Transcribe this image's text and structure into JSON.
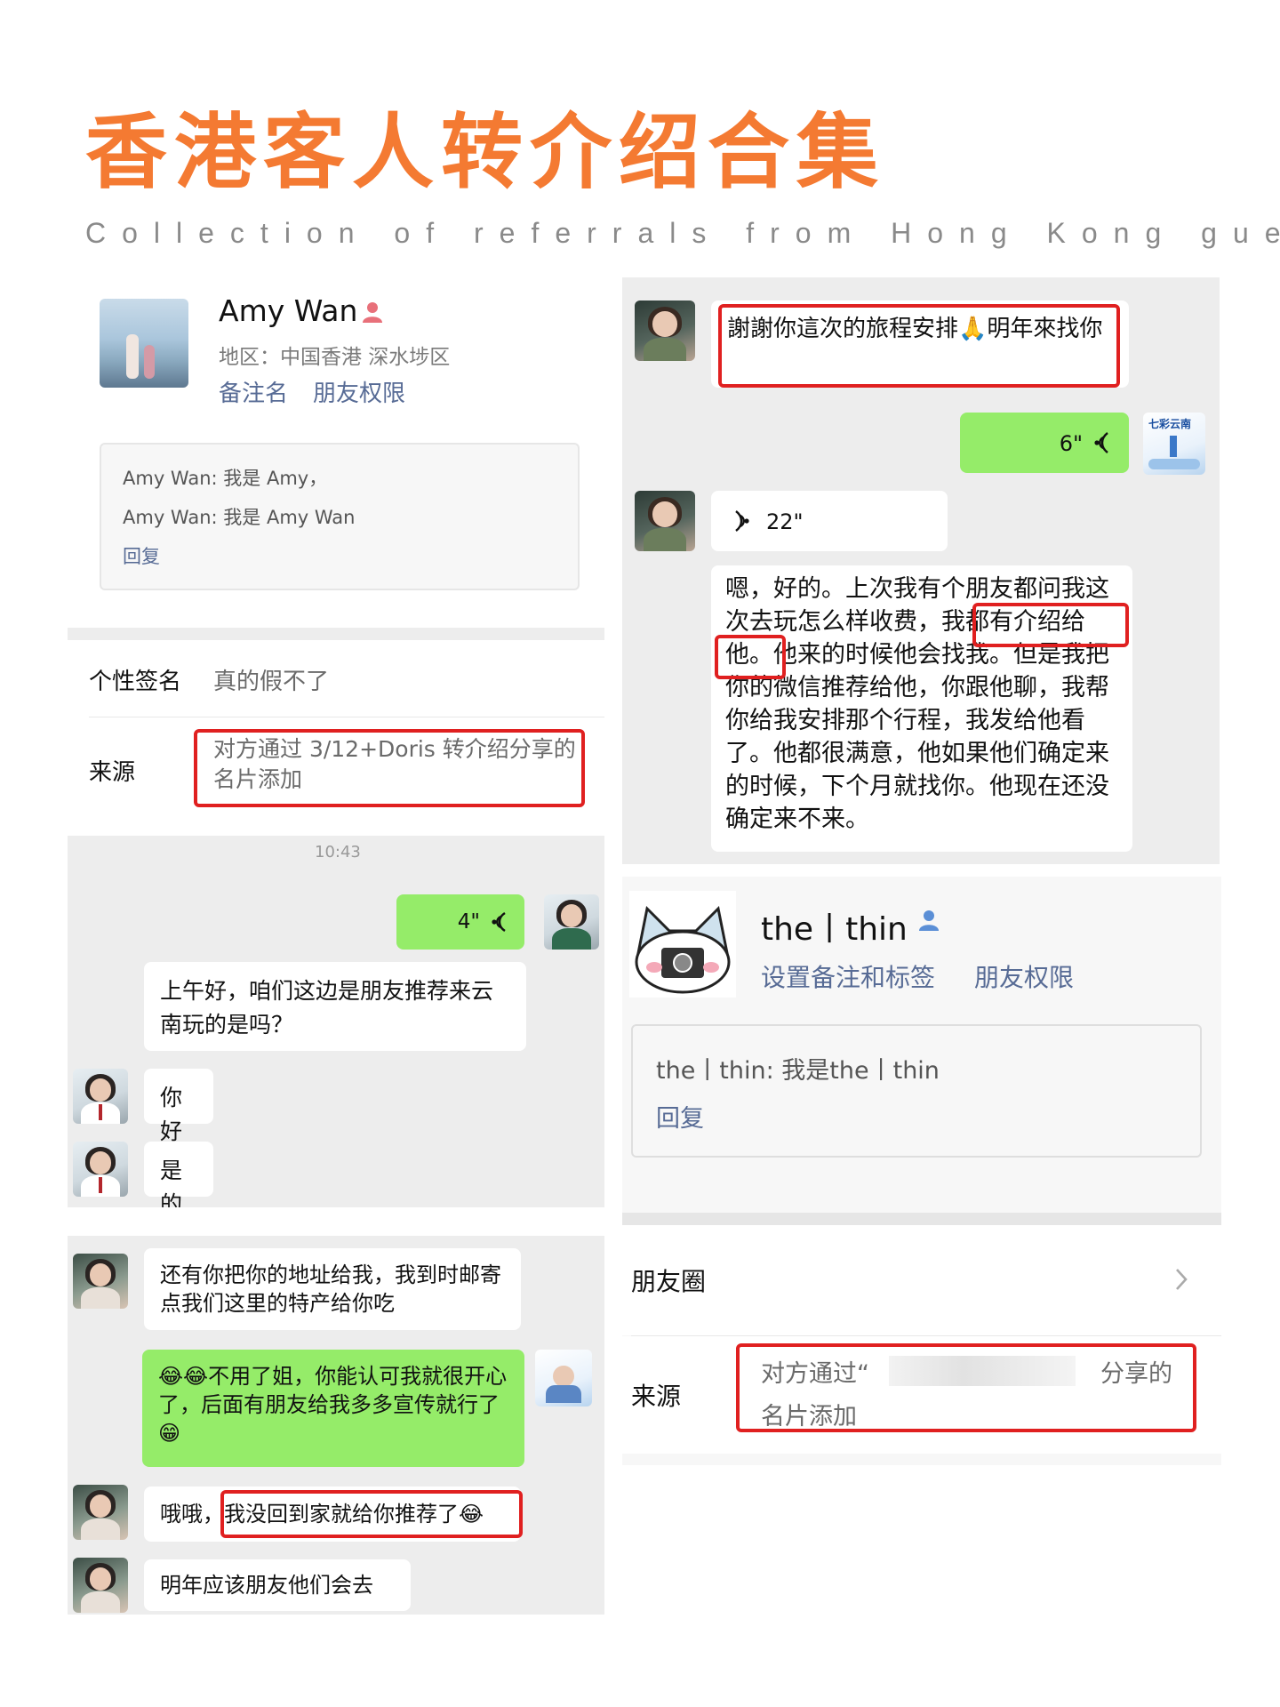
{
  "header": {
    "title": "香港客人转介绍合集",
    "subtitle": "Collection of referrals from Hong Kong guests"
  },
  "panel1": {
    "name": "Amy Wan",
    "region": "地区：中国香港 深水埗区",
    "remark_link": "备注名",
    "perm_link": "朋友权限",
    "greeting_line1": "Amy Wan: 我是 Amy，",
    "greeting_line2": "Amy Wan: 我是 Amy Wan",
    "reply": "回复",
    "signature_label": "个性签名",
    "signature_value": "真的假不了",
    "source_label": "来源",
    "source_value_line1": "对方通过 3/12+Doris 转介绍分享的",
    "source_value_line2": "名片添加"
  },
  "panel2": {
    "time": "10:43",
    "voice_out": "4\"",
    "msg1": "上午好，咱们这边是朋友推荐来云南玩的是吗？",
    "msg2": "你好",
    "msg3": "是的"
  },
  "panel3": {
    "msg1": "还有你把你的地址给我，我到时邮寄点我们这里的特产给你吃",
    "msg2": "😂😂不用了姐，你能认可我就很开心了，后面有朋友给我多多宣传就行了😁",
    "msg3_prefix": "哦哦，",
    "msg3_boxed": "我没回到家就给你推荐了😂",
    "msg4": "明年应该朋友他们会去"
  },
  "panel4": {
    "msg1": "謝謝你這次的旅程安排🙏明年來找你",
    "voice_out": "6\"",
    "voice_in": "22\"",
    "transcript_a": "嗯，好的。上次我有个朋友都问我这次去玩怎么样收费，",
    "transcript_boxed_a": "我都有介绍",
    "transcript_boxed_b": "给他。",
    "transcript_b": "他来的时候他会找我。但是我把你的微信推荐给他，你跟他聊，我帮你给我安排那个行程，我发给他看了。他都很满意，他如果他们确定来的时候，下个月就找你。他现在还没确定来不来。",
    "card_label": "七彩云南"
  },
  "panel5": {
    "name": "the丨thin",
    "remark_link": "设置备注和标签",
    "perm_link": "朋友权限",
    "greeting": "the丨thin: 我是the丨thin",
    "reply": "回复",
    "moments_label": "朋友圈",
    "source_label": "来源",
    "source_value_start": "对方通过“",
    "source_value_end": "分享的",
    "source_value_line2": "名片添加"
  },
  "icons": {
    "person_red": "person-red-icon",
    "person_blue": "person-blue-icon",
    "voice": "voice-icon",
    "chevron": "chevron-right-icon"
  },
  "colors": {
    "title": "#f47a32",
    "highlight": "#e02020",
    "link": "#576b95",
    "bubble_green": "#95ec69",
    "chat_bg": "#ededed"
  }
}
